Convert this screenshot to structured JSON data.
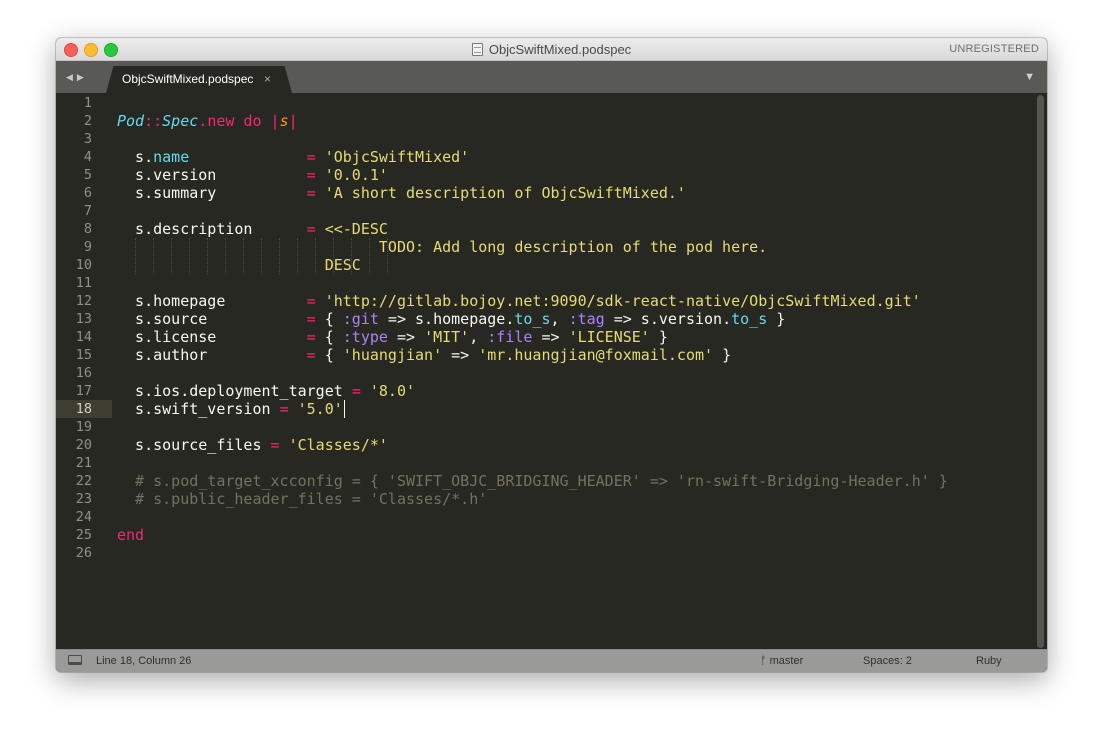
{
  "window": {
    "title": "ObjcSwiftMixed.podspec",
    "registration": "UNREGISTERED"
  },
  "tabs": [
    {
      "label": "ObjcSwiftMixed.podspec",
      "close": "×"
    }
  ],
  "nav": {
    "back": "◀",
    "forward": "▶",
    "dropdown": "▼"
  },
  "editor": {
    "current_line": 18,
    "line_numbers": [
      "1",
      "2",
      "3",
      "4",
      "5",
      "6",
      "7",
      "8",
      "9",
      "10",
      "11",
      "12",
      "13",
      "14",
      "15",
      "16",
      "17",
      "18",
      "19",
      "20",
      "21",
      "22",
      "23",
      "24",
      "25",
      "26"
    ],
    "lines": [
      [],
      [
        [
          "cls",
          "Pod"
        ],
        [
          "kw",
          "::"
        ],
        [
          "cls",
          "Spec"
        ],
        [
          "kw",
          "."
        ],
        [
          "kw",
          "new"
        ],
        [
          "wht",
          " "
        ],
        [
          "kw",
          "do"
        ],
        [
          "wht",
          " "
        ],
        [
          "kw",
          "|"
        ],
        [
          "blk",
          "s"
        ],
        [
          "kw",
          "|"
        ]
      ],
      [],
      [
        [
          "wht",
          "  s."
        ],
        [
          "mth",
          "name"
        ],
        [
          "wht",
          "             "
        ],
        [
          "kw",
          "="
        ],
        [
          "wht",
          " "
        ],
        [
          "str",
          "'ObjcSwiftMixed'"
        ]
      ],
      [
        [
          "wht",
          "  s.version          "
        ],
        [
          "kw",
          "="
        ],
        [
          "wht",
          " "
        ],
        [
          "str",
          "'0.0.1'"
        ]
      ],
      [
        [
          "wht",
          "  s.summary          "
        ],
        [
          "kw",
          "="
        ],
        [
          "wht",
          " "
        ],
        [
          "str",
          "'A short description of ObjcSwiftMixed.'"
        ]
      ],
      [],
      [
        [
          "wht",
          "  s.description      "
        ],
        [
          "kw",
          "="
        ],
        [
          "wht",
          " "
        ],
        [
          "str",
          "<<-DESC"
        ]
      ],
      [
        [
          "str",
          "                             TODO: Add long description of the pod here."
        ]
      ],
      [
        [
          "str",
          "                       DESC"
        ]
      ],
      [],
      [
        [
          "wht",
          "  s.homepage         "
        ],
        [
          "kw",
          "="
        ],
        [
          "wht",
          " "
        ],
        [
          "str",
          "'http://gitlab.bojoy.net:9090/sdk-react-native/ObjcSwiftMixed.git'"
        ]
      ],
      [
        [
          "wht",
          "  s.source           "
        ],
        [
          "kw",
          "="
        ],
        [
          "wht",
          " { "
        ],
        [
          "sym",
          ":git"
        ],
        [
          "wht",
          " => s.homepage."
        ],
        [
          "mth",
          "to_s"
        ],
        [
          "wht",
          ", "
        ],
        [
          "sym",
          ":tag"
        ],
        [
          "wht",
          " => s.version."
        ],
        [
          "mth",
          "to_s"
        ],
        [
          "wht",
          " }"
        ]
      ],
      [
        [
          "wht",
          "  s.license          "
        ],
        [
          "kw",
          "="
        ],
        [
          "wht",
          " { "
        ],
        [
          "sym",
          ":type"
        ],
        [
          "wht",
          " => "
        ],
        [
          "str",
          "'MIT'"
        ],
        [
          "wht",
          ", "
        ],
        [
          "sym",
          ":file"
        ],
        [
          "wht",
          " => "
        ],
        [
          "str",
          "'LICENSE'"
        ],
        [
          "wht",
          " }"
        ]
      ],
      [
        [
          "wht",
          "  s.author           "
        ],
        [
          "kw",
          "="
        ],
        [
          "wht",
          " { "
        ],
        [
          "str",
          "'huangjian'"
        ],
        [
          "wht",
          " => "
        ],
        [
          "str",
          "'mr.huangjian@foxmail.com'"
        ],
        [
          "wht",
          " }"
        ]
      ],
      [],
      [
        [
          "wht",
          "  s.ios.deployment_target "
        ],
        [
          "kw",
          "="
        ],
        [
          "wht",
          " "
        ],
        [
          "str",
          "'8.0'"
        ]
      ],
      [
        [
          "wht",
          "  s.swift_version "
        ],
        [
          "kw",
          "="
        ],
        [
          "wht",
          " "
        ],
        [
          "str",
          "'5.0'"
        ]
      ],
      [],
      [
        [
          "wht",
          "  s.source_files "
        ],
        [
          "kw",
          "="
        ],
        [
          "wht",
          " "
        ],
        [
          "str",
          "'Classes/*'"
        ]
      ],
      [],
      [
        [
          "cmt",
          "  # s.pod_target_xcconfig = { 'SWIFT_OBJC_BRIDGING_HEADER' => 'rn-swift-Bridging-Header.h' }"
        ]
      ],
      [
        [
          "cmt",
          "  # s.public_header_files = 'Classes/*.h'"
        ]
      ],
      [],
      [
        [
          "kw",
          "end"
        ]
      ],
      []
    ]
  },
  "status": {
    "position": "Line 18, Column 26",
    "branch_icon": "git-branch-icon",
    "branch": "master",
    "indent": "Spaces: 2",
    "syntax": "Ruby"
  },
  "colors": {
    "background": "#272822",
    "keyword": "#f92672",
    "string": "#e6db74",
    "class": "#66d9ef",
    "symbol": "#ae81ff",
    "comment": "#75715e"
  }
}
